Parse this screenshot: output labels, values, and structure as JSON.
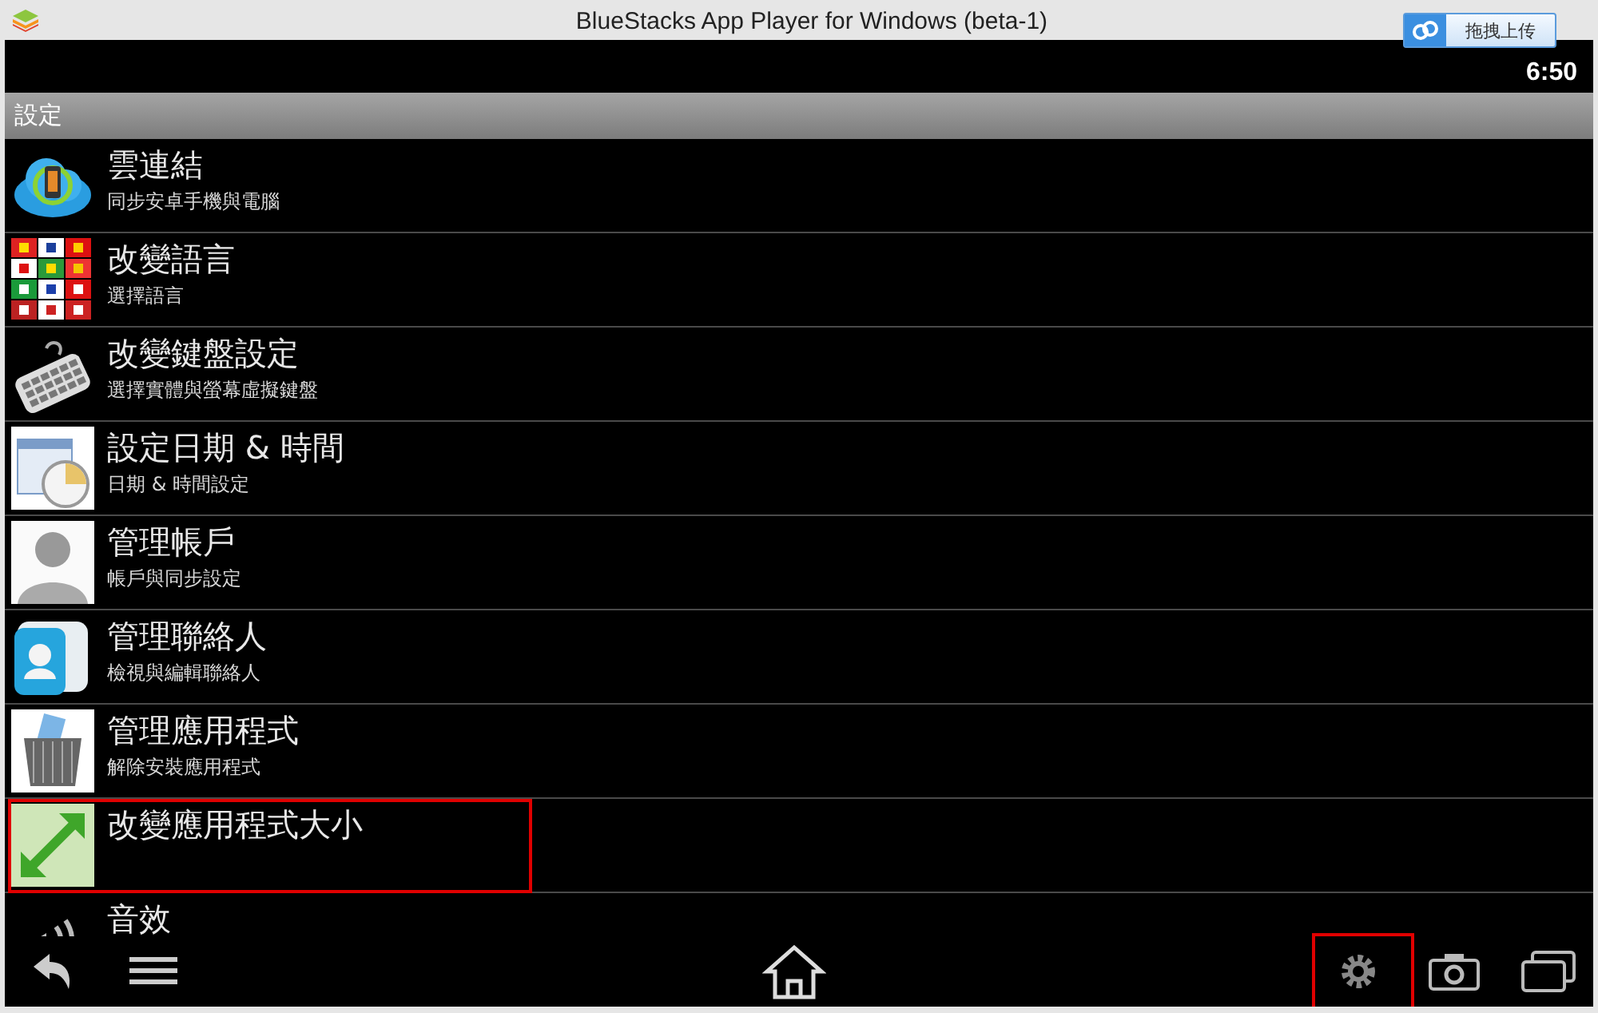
{
  "window": {
    "title": "BlueStacks App Player for Windows (beta-1)"
  },
  "upload_button": {
    "label": "拖拽上传"
  },
  "status_bar": {
    "time": "6:50"
  },
  "header": {
    "title": "設定"
  },
  "settings": [
    {
      "title": "雲連結",
      "subtitle": "同步安卓手機與電腦",
      "highlighted": false
    },
    {
      "title": "改變語言",
      "subtitle": "選擇語言",
      "highlighted": false
    },
    {
      "title": "改變鍵盤設定",
      "subtitle": "選擇實體與螢幕虛擬鍵盤",
      "highlighted": false
    },
    {
      "title": "設定日期 & 時間",
      "subtitle": "日期 & 時間設定",
      "highlighted": false
    },
    {
      "title": "管理帳戶",
      "subtitle": "帳戶與同步設定",
      "highlighted": false
    },
    {
      "title": "管理聯絡人",
      "subtitle": "檢視與編輯聯絡人",
      "highlighted": false
    },
    {
      "title": "管理應用程式",
      "subtitle": "解除安裝應用程式",
      "highlighted": false
    },
    {
      "title": "改變應用程式大小",
      "highlighted": true
    },
    {
      "title": "音效",
      "highlighted": false
    }
  ],
  "nav_bar": {
    "settings_highlighted": true
  }
}
